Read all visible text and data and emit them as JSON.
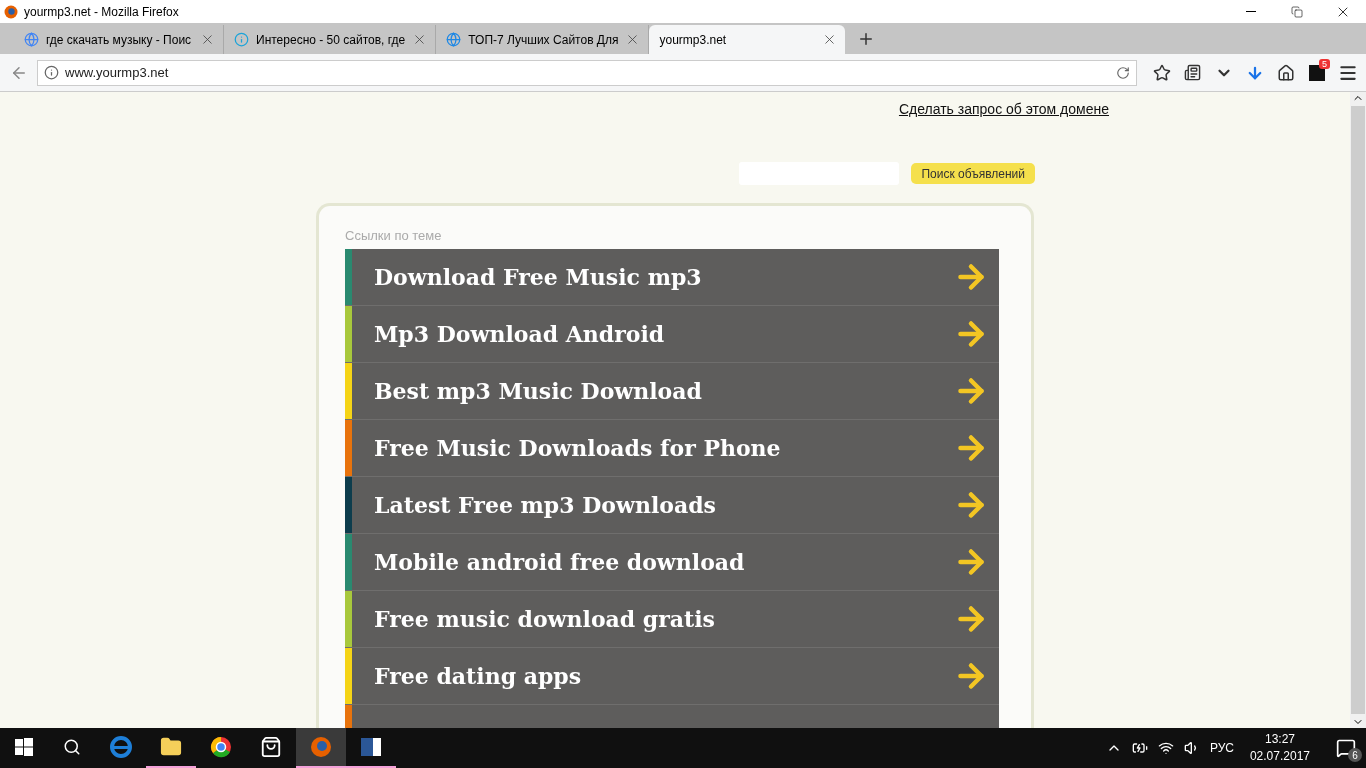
{
  "window": {
    "title": "yourmp3.net - Mozilla Firefox"
  },
  "tabs": [
    {
      "label": "где скачать музыку - Поис",
      "selected": false
    },
    {
      "label": "Интересно - 50 сайтов, где",
      "selected": false
    },
    {
      "label": "ТОП-7 Лучших Сайтов Для",
      "selected": false
    },
    {
      "label": "yourmp3.net",
      "selected": true
    }
  ],
  "address_bar": {
    "value": "www.yourmp3.net"
  },
  "toolbar": {
    "badge": "5"
  },
  "page": {
    "domain_link": "Сделать запрос об этом домене",
    "search_button": "Поиск объявлений",
    "section_label": "Ссылки по теме",
    "links": [
      {
        "label": "Download Free Music mp3",
        "color": "#2a8a70"
      },
      {
        "label": "Mp3 Download Android",
        "color": "#a8c83c"
      },
      {
        "label": "Best mp3 Music Download",
        "color": "#f5d416"
      },
      {
        "label": "Free Music Downloads for Phone",
        "color": "#e8730c"
      },
      {
        "label": "Latest Free mp3 Downloads",
        "color": "#0d3d4d"
      },
      {
        "label": "Mobile android free download",
        "color": "#2a8a70"
      },
      {
        "label": "Free music download gratis",
        "color": "#a8c83c"
      },
      {
        "label": "Free dating apps",
        "color": "#f5d416"
      },
      {
        "color": "#e8730c"
      }
    ]
  },
  "taskbar": {
    "apps": [
      {
        "running": false,
        "selected": false
      },
      {
        "running": true,
        "selected": false
      },
      {
        "running": false,
        "selected": false
      },
      {
        "running": false,
        "selected": false
      },
      {
        "running": true,
        "selected": true
      },
      {
        "running": true,
        "selected": false
      }
    ],
    "language": "РУС",
    "time": "13:27",
    "date": "02.07.2017",
    "notifications": "6"
  }
}
